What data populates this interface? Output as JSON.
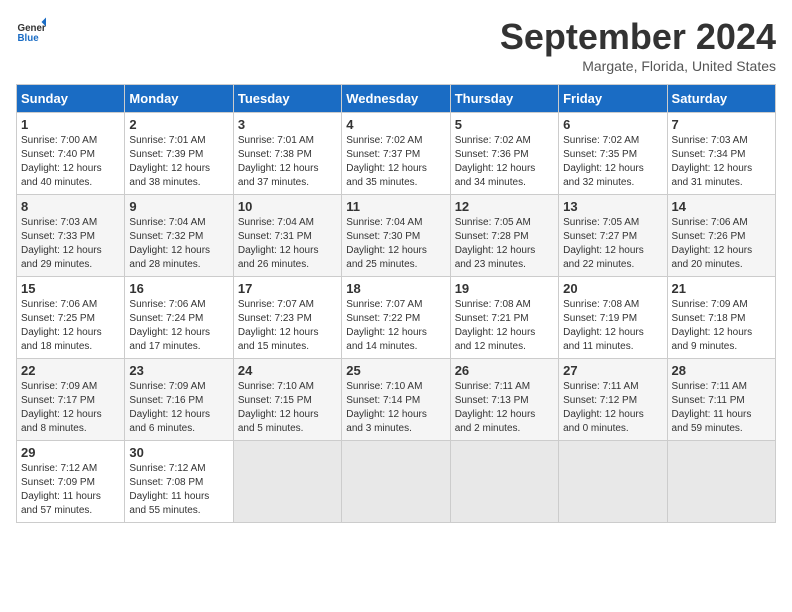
{
  "header": {
    "logo_line1": "General",
    "logo_line2": "Blue",
    "title": "September 2024",
    "subtitle": "Margate, Florida, United States"
  },
  "days_of_week": [
    "Sunday",
    "Monday",
    "Tuesday",
    "Wednesday",
    "Thursday",
    "Friday",
    "Saturday"
  ],
  "weeks": [
    [
      {
        "day": "1",
        "info": "Sunrise: 7:00 AM\nSunset: 7:40 PM\nDaylight: 12 hours\nand 40 minutes."
      },
      {
        "day": "2",
        "info": "Sunrise: 7:01 AM\nSunset: 7:39 PM\nDaylight: 12 hours\nand 38 minutes."
      },
      {
        "day": "3",
        "info": "Sunrise: 7:01 AM\nSunset: 7:38 PM\nDaylight: 12 hours\nand 37 minutes."
      },
      {
        "day": "4",
        "info": "Sunrise: 7:02 AM\nSunset: 7:37 PM\nDaylight: 12 hours\nand 35 minutes."
      },
      {
        "day": "5",
        "info": "Sunrise: 7:02 AM\nSunset: 7:36 PM\nDaylight: 12 hours\nand 34 minutes."
      },
      {
        "day": "6",
        "info": "Sunrise: 7:02 AM\nSunset: 7:35 PM\nDaylight: 12 hours\nand 32 minutes."
      },
      {
        "day": "7",
        "info": "Sunrise: 7:03 AM\nSunset: 7:34 PM\nDaylight: 12 hours\nand 31 minutes."
      }
    ],
    [
      {
        "day": "8",
        "info": "Sunrise: 7:03 AM\nSunset: 7:33 PM\nDaylight: 12 hours\nand 29 minutes."
      },
      {
        "day": "9",
        "info": "Sunrise: 7:04 AM\nSunset: 7:32 PM\nDaylight: 12 hours\nand 28 minutes."
      },
      {
        "day": "10",
        "info": "Sunrise: 7:04 AM\nSunset: 7:31 PM\nDaylight: 12 hours\nand 26 minutes."
      },
      {
        "day": "11",
        "info": "Sunrise: 7:04 AM\nSunset: 7:30 PM\nDaylight: 12 hours\nand 25 minutes."
      },
      {
        "day": "12",
        "info": "Sunrise: 7:05 AM\nSunset: 7:28 PM\nDaylight: 12 hours\nand 23 minutes."
      },
      {
        "day": "13",
        "info": "Sunrise: 7:05 AM\nSunset: 7:27 PM\nDaylight: 12 hours\nand 22 minutes."
      },
      {
        "day": "14",
        "info": "Sunrise: 7:06 AM\nSunset: 7:26 PM\nDaylight: 12 hours\nand 20 minutes."
      }
    ],
    [
      {
        "day": "15",
        "info": "Sunrise: 7:06 AM\nSunset: 7:25 PM\nDaylight: 12 hours\nand 18 minutes."
      },
      {
        "day": "16",
        "info": "Sunrise: 7:06 AM\nSunset: 7:24 PM\nDaylight: 12 hours\nand 17 minutes."
      },
      {
        "day": "17",
        "info": "Sunrise: 7:07 AM\nSunset: 7:23 PM\nDaylight: 12 hours\nand 15 minutes."
      },
      {
        "day": "18",
        "info": "Sunrise: 7:07 AM\nSunset: 7:22 PM\nDaylight: 12 hours\nand 14 minutes."
      },
      {
        "day": "19",
        "info": "Sunrise: 7:08 AM\nSunset: 7:21 PM\nDaylight: 12 hours\nand 12 minutes."
      },
      {
        "day": "20",
        "info": "Sunrise: 7:08 AM\nSunset: 7:19 PM\nDaylight: 12 hours\nand 11 minutes."
      },
      {
        "day": "21",
        "info": "Sunrise: 7:09 AM\nSunset: 7:18 PM\nDaylight: 12 hours\nand 9 minutes."
      }
    ],
    [
      {
        "day": "22",
        "info": "Sunrise: 7:09 AM\nSunset: 7:17 PM\nDaylight: 12 hours\nand 8 minutes."
      },
      {
        "day": "23",
        "info": "Sunrise: 7:09 AM\nSunset: 7:16 PM\nDaylight: 12 hours\nand 6 minutes."
      },
      {
        "day": "24",
        "info": "Sunrise: 7:10 AM\nSunset: 7:15 PM\nDaylight: 12 hours\nand 5 minutes."
      },
      {
        "day": "25",
        "info": "Sunrise: 7:10 AM\nSunset: 7:14 PM\nDaylight: 12 hours\nand 3 minutes."
      },
      {
        "day": "26",
        "info": "Sunrise: 7:11 AM\nSunset: 7:13 PM\nDaylight: 12 hours\nand 2 minutes."
      },
      {
        "day": "27",
        "info": "Sunrise: 7:11 AM\nSunset: 7:12 PM\nDaylight: 12 hours\nand 0 minutes."
      },
      {
        "day": "28",
        "info": "Sunrise: 7:11 AM\nSunset: 7:11 PM\nDaylight: 11 hours\nand 59 minutes."
      }
    ],
    [
      {
        "day": "29",
        "info": "Sunrise: 7:12 AM\nSunset: 7:09 PM\nDaylight: 11 hours\nand 57 minutes."
      },
      {
        "day": "30",
        "info": "Sunrise: 7:12 AM\nSunset: 7:08 PM\nDaylight: 11 hours\nand 55 minutes."
      },
      {
        "day": "",
        "info": ""
      },
      {
        "day": "",
        "info": ""
      },
      {
        "day": "",
        "info": ""
      },
      {
        "day": "",
        "info": ""
      },
      {
        "day": "",
        "info": ""
      }
    ]
  ]
}
